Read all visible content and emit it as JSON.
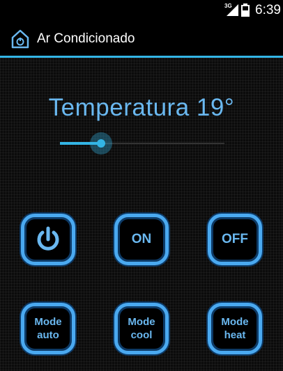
{
  "status_bar": {
    "network_label": "3G",
    "time": "6:39"
  },
  "action_bar": {
    "title": "Ar Condicionado",
    "icon": "home-remote-icon"
  },
  "temperature": {
    "label": "Temperatura 19°",
    "slider_fraction": 0.25
  },
  "buttons": {
    "power": {
      "icon": "power-icon"
    },
    "on": {
      "label": "ON"
    },
    "off": {
      "label": "OFF"
    },
    "mode_auto": {
      "label": "Mode\nauto"
    },
    "mode_cool": {
      "label": "Mode\ncool"
    },
    "mode_heat": {
      "label": "Mode\nheat"
    }
  },
  "colors": {
    "accent": "#33b5e5",
    "button_border": "#4aa9f0",
    "text_accent": "#6ab8f0"
  }
}
